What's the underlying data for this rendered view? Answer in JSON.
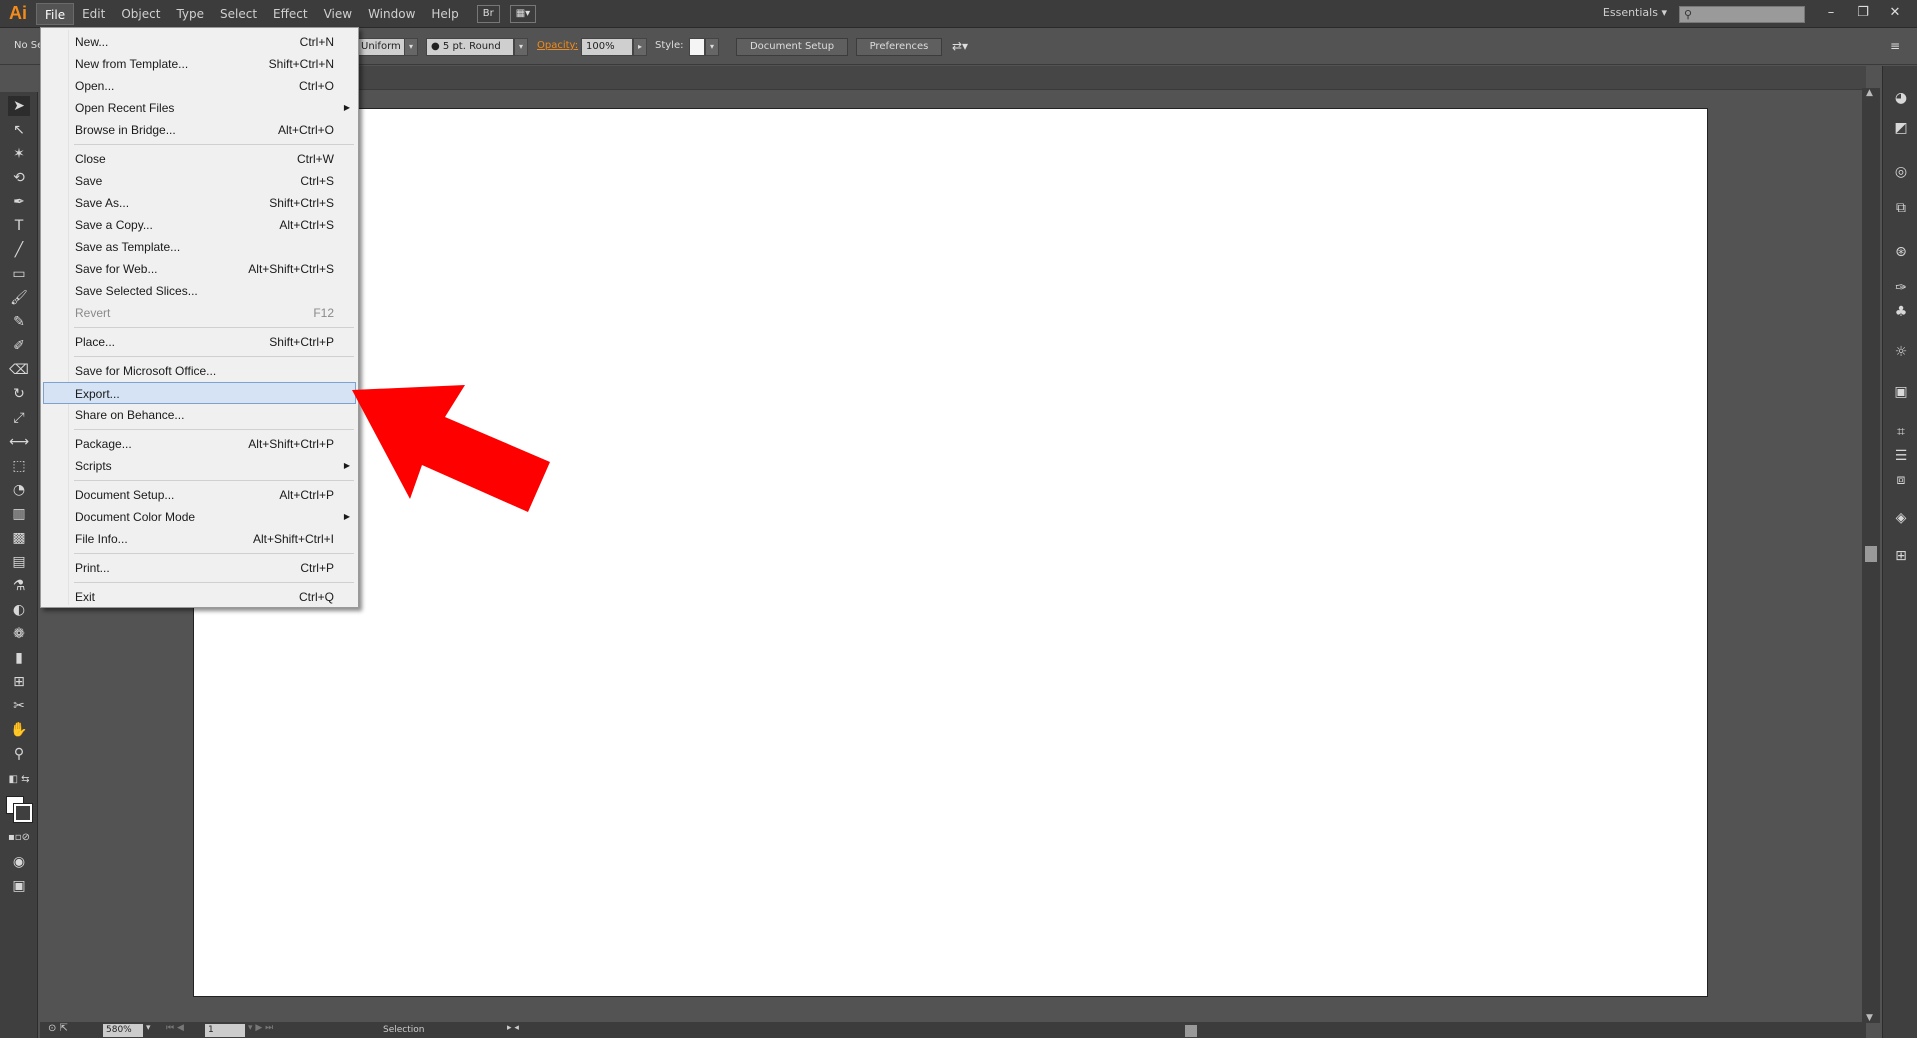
{
  "app": {
    "logo": "Ai"
  },
  "menubar": {
    "items": [
      "File",
      "Edit",
      "Object",
      "Type",
      "Select",
      "Effect",
      "View",
      "Window",
      "Help"
    ],
    "bridge_button": "Br",
    "workspace": "Essentials"
  },
  "controlbar": {
    "selection_label": "No Se",
    "stroke_profile": "Uniform",
    "brush": "5 pt. Round",
    "opacity_label": "Opacity:",
    "opacity_value": "100%",
    "style_label": "Style:",
    "document_setup": "Document Setup",
    "preferences": "Preferences"
  },
  "statusbar": {
    "zoom": "580%",
    "page": "1",
    "status": "Selection"
  },
  "file_menu": {
    "items": [
      {
        "label": "New...",
        "shortcut": "Ctrl+N"
      },
      {
        "label": "New from Template...",
        "shortcut": "Shift+Ctrl+N"
      },
      {
        "label": "Open...",
        "shortcut": "Ctrl+O"
      },
      {
        "label": "Open Recent Files",
        "shortcut": ""
      },
      {
        "label": "Browse in Bridge...",
        "shortcut": "Alt+Ctrl+O"
      },
      {
        "label": "Close",
        "shortcut": "Ctrl+W"
      },
      {
        "label": "Save",
        "shortcut": "Ctrl+S"
      },
      {
        "label": "Save As...",
        "shortcut": "Shift+Ctrl+S"
      },
      {
        "label": "Save a Copy...",
        "shortcut": "Alt+Ctrl+S"
      },
      {
        "label": "Save as Template...",
        "shortcut": ""
      },
      {
        "label": "Save for Web...",
        "shortcut": "Alt+Shift+Ctrl+S"
      },
      {
        "label": "Save Selected Slices...",
        "shortcut": ""
      },
      {
        "label": "Revert",
        "shortcut": "F12"
      },
      {
        "label": "Place...",
        "shortcut": "Shift+Ctrl+P"
      },
      {
        "label": "Save for Microsoft Office...",
        "shortcut": ""
      },
      {
        "label": "Export...",
        "shortcut": ""
      },
      {
        "label": "Share on Behance...",
        "shortcut": ""
      },
      {
        "label": "Package...",
        "shortcut": "Alt+Shift+Ctrl+P"
      },
      {
        "label": "Scripts",
        "shortcut": ""
      },
      {
        "label": "Document Setup...",
        "shortcut": "Alt+Ctrl+P"
      },
      {
        "label": "Document Color Mode",
        "shortcut": ""
      },
      {
        "label": "File Info...",
        "shortcut": "Alt+Shift+Ctrl+I"
      },
      {
        "label": "Print...",
        "shortcut": "Ctrl+P"
      },
      {
        "label": "Exit",
        "shortcut": "Ctrl+Q"
      }
    ]
  },
  "annotation": {
    "arrow_color": "#ff0000"
  }
}
